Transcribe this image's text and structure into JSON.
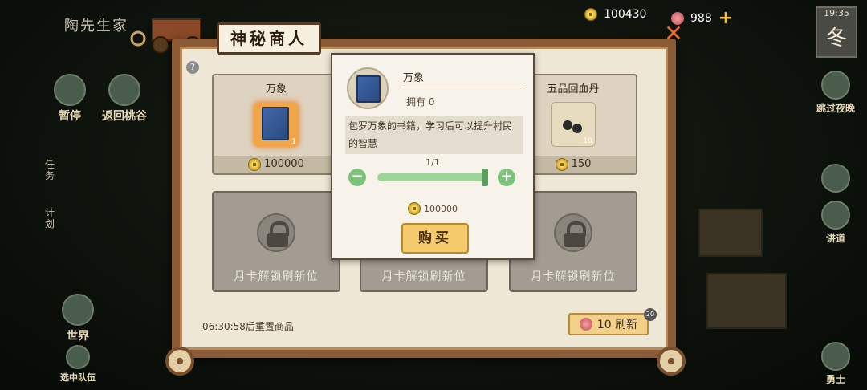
{
  "hud": {
    "player_name": "陶先生家",
    "coins": "100430",
    "gems": "988",
    "clock_time": "19:35",
    "season": "冬"
  },
  "left_menu": [
    {
      "label": "暂停"
    },
    {
      "label": "返回桃谷"
    },
    {
      "label": "世界"
    },
    {
      "label": "选中队伍"
    }
  ],
  "side_tabs": [
    {
      "label": "任务"
    },
    {
      "label": "计划"
    }
  ],
  "right_menu": [
    {
      "label": "跳过夜晚"
    },
    {
      "label": "讲道"
    },
    {
      "label": "勇士"
    }
  ],
  "shop": {
    "title": "神秘商人",
    "help": "?",
    "close": "✕",
    "slots": [
      {
        "name": "万象",
        "qty": "1",
        "price": "100000"
      },
      {
        "name": "五品回血丹",
        "qty": "10",
        "price": "150"
      }
    ],
    "locked_label": "月卡解锁刷新位",
    "reset_text": "06:30:58后重置商品",
    "refresh_label": "10 刷新",
    "refresh_badge": "20"
  },
  "popup": {
    "title": "万象",
    "owned": "拥有 0",
    "description": "包罗万象的书籍，学习后可以提升村民的智慧",
    "counter": "1/1",
    "quantity_fraction": 1.0,
    "minus": "−",
    "plus": "+",
    "cost": "100000",
    "buy_label": "购买"
  },
  "colors": {
    "accent_gold": "#f3cb6c",
    "slider_green": "#7bc47a",
    "close_orange": "#f06a2a"
  }
}
